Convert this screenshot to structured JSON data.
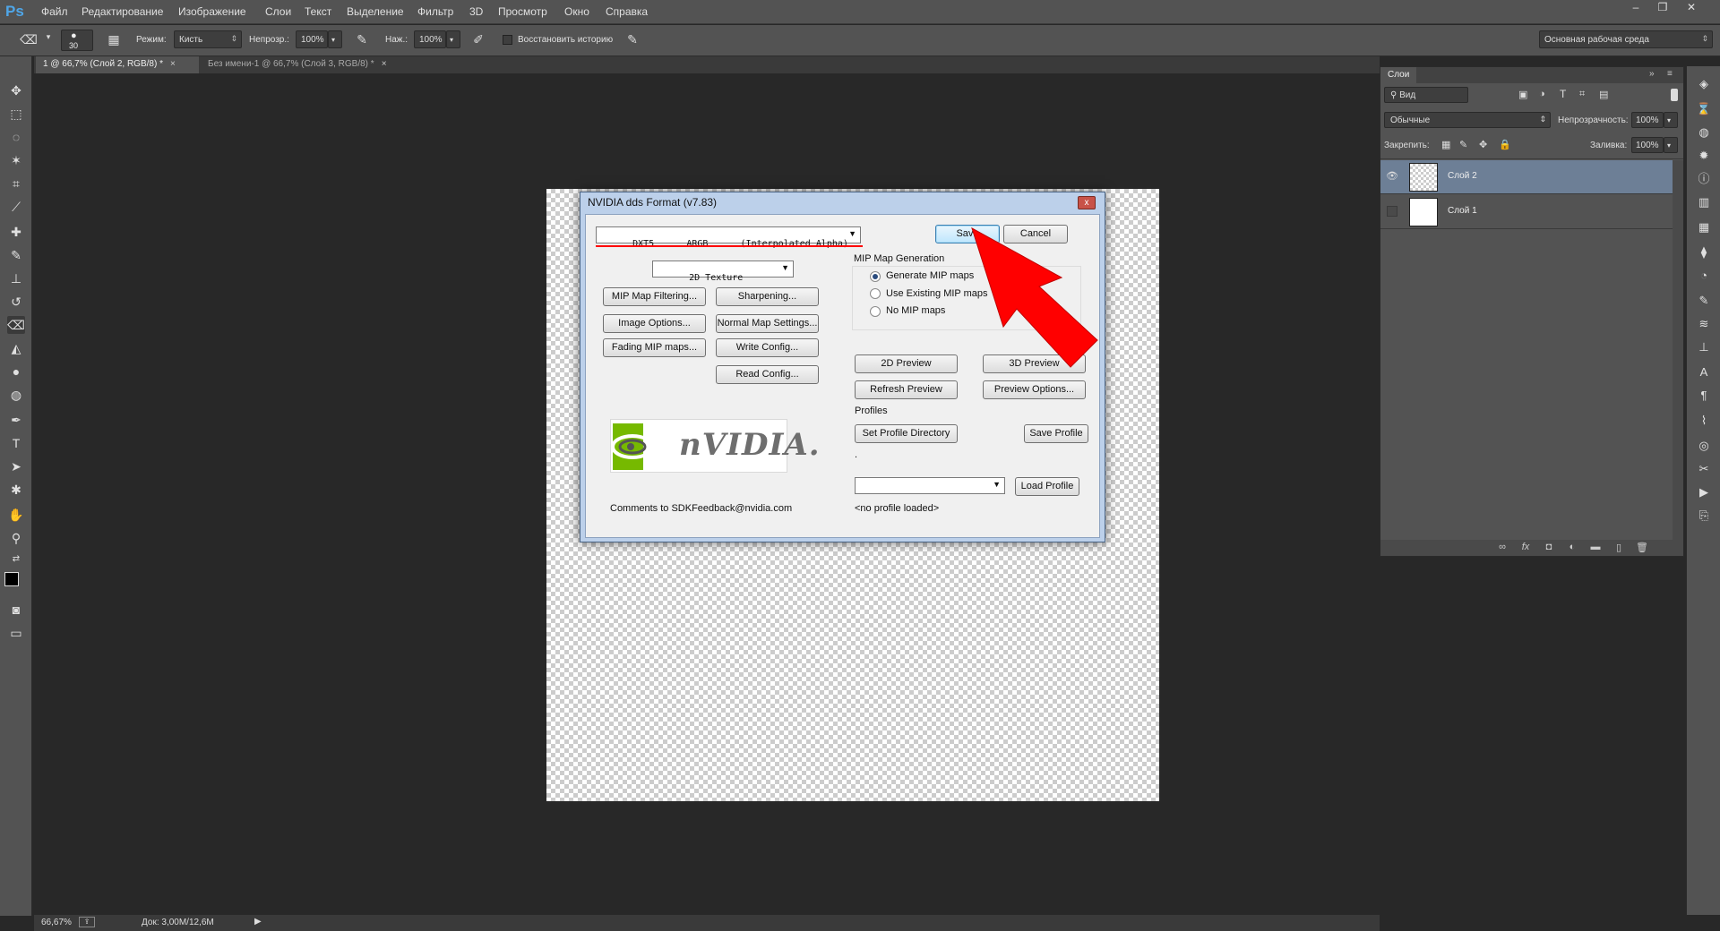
{
  "app": {
    "logo": "Ps",
    "menu": [
      "Файл",
      "Редактирование",
      "Изображение",
      "Слои",
      "Текст",
      "Выделение",
      "Фильтр",
      "3D",
      "Просмотр",
      "Окно",
      "Справка"
    ],
    "window_controls": [
      "–",
      "❐",
      "✕"
    ]
  },
  "options_bar": {
    "brush_size": "30",
    "mode_label": "Режим:",
    "mode_value": "Кисть",
    "opacity_label": "Непрозр.:",
    "opacity_value": "100%",
    "pressure_label": "Наж.:",
    "pressure_value": "100%",
    "restore_history_label": "Восстановить историю",
    "workspace": "Основная рабочая среда"
  },
  "tabs": [
    {
      "label": "1 @ 66,7% (Слой 2, RGB/8) *",
      "close": "×"
    },
    {
      "label": "Без имени-1 @ 66,7% (Слой 3, RGB/8) *",
      "close": "×"
    }
  ],
  "status": {
    "zoom": "66,67%",
    "doc_info": "Док: 3,00M/12,6M"
  },
  "layers_panel": {
    "title": "Слои",
    "filter_label": "Вид",
    "blend_mode": "Обычные",
    "opacity_label": "Непрозрачность:",
    "opacity_value": "100%",
    "lock_label": "Закрепить:",
    "fill_label": "Заливка:",
    "fill_value": "100%",
    "layers": [
      {
        "name": "Слой 2",
        "selected": true,
        "visible": true
      },
      {
        "name": "Слой 1",
        "selected": false,
        "visible": false
      }
    ]
  },
  "dialog": {
    "title": "NVIDIA dds Format (v7.83)",
    "close": "x",
    "format_combo": "DXT5      ARGB      (Interpolated Alpha)",
    "texture_combo": "2D Texture",
    "save": "Save",
    "cancel": "Cancel",
    "buttons_left": {
      "mip_filtering": "MIP Map Filtering...",
      "sharpening": "Sharpening...",
      "image_options": "Image Options...",
      "normal_map": "Normal Map Settings...",
      "fading": "Fading MIP maps...",
      "write_config": "Write Config...",
      "read_config": "Read Config..."
    },
    "mip_group": {
      "label": "MIP Map Generation",
      "options": [
        "Generate MIP maps",
        "Use Existing MIP maps",
        "No MIP maps"
      ],
      "selected_index": 0
    },
    "preview_2d": "2D Preview",
    "preview_3d": "3D Preview",
    "refresh_preview": "Refresh Preview",
    "preview_options": "Preview Options...",
    "profiles_label": "Profiles",
    "set_profile_dir": "Set Profile Directory",
    "save_profile": "Save Profile",
    "dot": ".",
    "load_profile": "Load Profile",
    "no_profile": "<no profile loaded>",
    "logo_text": "nVIDIA.",
    "comments": "Comments to SDKFeedback@nvidia.com"
  },
  "colors": {
    "accent_red": "#ff0000",
    "nvidia_green": "#76b900",
    "selected_layer": "#6d7f96"
  }
}
